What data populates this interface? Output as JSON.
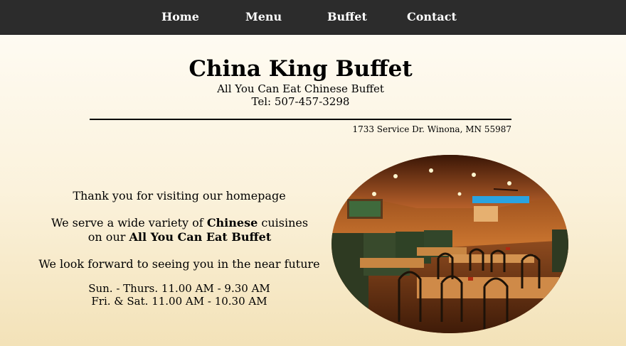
{
  "nav": {
    "home": "Home",
    "menu": "Menu",
    "buffet": "Buffet",
    "contact": "Contact"
  },
  "header": {
    "title": "China King Buffet",
    "subtitle": "All You Can Eat Chinese Buffet",
    "tel": "Tel: 507-457-3298",
    "address": "1733 Service Dr. Winona, MN 55987"
  },
  "main": {
    "welcome": "Thank you for visiting our homepage",
    "desc_pre": "We serve a wide variety of ",
    "desc_bold1": "Chinese",
    "desc_mid": " cuisines on our ",
    "desc_bold2": "All You Can Eat Buffet",
    "future": "We look forward to seeing you in the near future",
    "hours_weekday": "Sun. - Thurs. 11.00 AM - 9.30 AM",
    "hours_weekend": "Fri. & Sat. 11.00 AM - 10.30 AM"
  },
  "colors": {
    "nav_bg": "#2c2c2c",
    "page_bg_top": "#fffdf7",
    "page_bg_bottom": "#f3e2b8"
  }
}
